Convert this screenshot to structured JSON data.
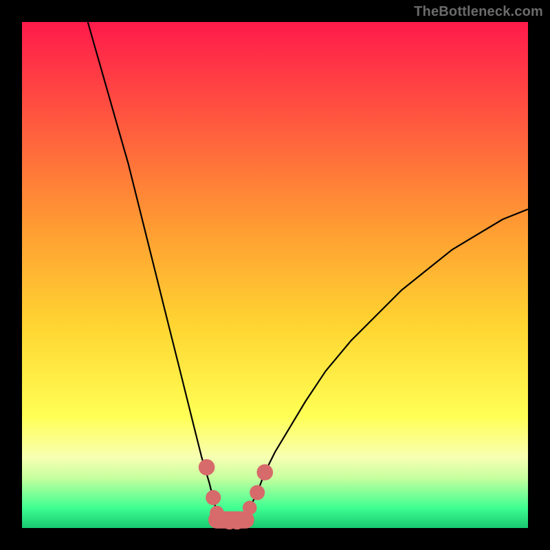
{
  "watermark": "TheBottleneck.com",
  "background_gradient": {
    "stops": [
      {
        "pos": 0.0,
        "color": "#ff1a4b"
      },
      {
        "pos": 0.18,
        "color": "#ff5340"
      },
      {
        "pos": 0.4,
        "color": "#ff9a33"
      },
      {
        "pos": 0.6,
        "color": "#ffd531"
      },
      {
        "pos": 0.78,
        "color": "#ffff55"
      },
      {
        "pos": 0.86,
        "color": "#f8ffb2"
      },
      {
        "pos": 0.9,
        "color": "#c8ff9f"
      },
      {
        "pos": 0.96,
        "color": "#3fff91"
      },
      {
        "pos": 1.0,
        "color": "#18c971"
      }
    ]
  },
  "chart_data": {
    "type": "line",
    "title": "",
    "xlabel": "",
    "ylabel": "",
    "xlim": [
      0,
      100
    ],
    "ylim": [
      0,
      100
    ],
    "grid": false,
    "legend": false,
    "y_inverted_display": true,
    "series": [
      {
        "name": "left-branch",
        "x": [
          13,
          15,
          17,
          19,
          21,
          23,
          25,
          27,
          29,
          31,
          32.5,
          34,
          35.5,
          37,
          38,
          38.5
        ],
        "y": [
          100,
          93,
          86,
          79,
          72,
          64,
          56,
          48,
          40,
          32,
          26,
          20,
          14,
          9,
          5,
          3
        ]
      },
      {
        "name": "right-branch",
        "x": [
          44,
          45,
          46.5,
          48,
          50,
          53,
          56,
          60,
          65,
          70,
          75,
          80,
          85,
          90,
          95,
          100
        ],
        "y": [
          2,
          4,
          7,
          11,
          15,
          20,
          25,
          31,
          37,
          42,
          47,
          51,
          55,
          58,
          61,
          63
        ]
      }
    ],
    "markers": [
      {
        "name": "left-marker-a",
        "x": 36.5,
        "y": 12,
        "r": 1.6
      },
      {
        "name": "left-marker-b",
        "x": 37.8,
        "y": 6,
        "r": 1.5
      },
      {
        "name": "left-marker-c",
        "x": 38.5,
        "y": 3,
        "r": 1.4
      },
      {
        "name": "bottom-marker-a",
        "x": 39.5,
        "y": 1.5,
        "r": 1.5
      },
      {
        "name": "bottom-marker-b",
        "x": 41.0,
        "y": 1.2,
        "r": 1.5
      },
      {
        "name": "bottom-marker-c",
        "x": 42.5,
        "y": 1.2,
        "r": 1.5
      },
      {
        "name": "bottom-marker-d",
        "x": 43.8,
        "y": 1.8,
        "r": 1.5
      },
      {
        "name": "right-marker-a",
        "x": 45.0,
        "y": 4,
        "r": 1.4
      },
      {
        "name": "right-marker-b",
        "x": 46.5,
        "y": 7,
        "r": 1.5
      },
      {
        "name": "right-marker-c",
        "x": 48.0,
        "y": 11,
        "r": 1.6
      }
    ],
    "floor_segment": {
      "name": "valley-floor",
      "x0": 38.5,
      "x1": 44.2,
      "y": 1.6,
      "thickness": 3.4
    },
    "marker_color": "#d76a6a",
    "line_color": "#000000"
  }
}
